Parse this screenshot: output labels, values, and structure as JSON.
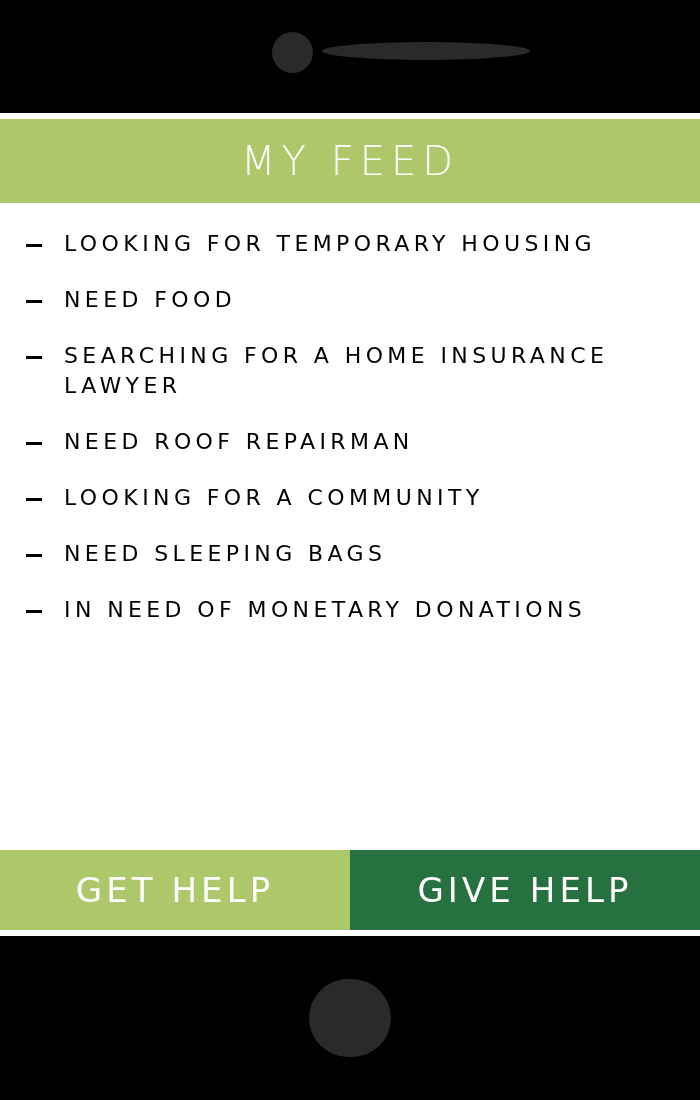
{
  "header": {
    "title": "MY FEED"
  },
  "feed": {
    "items": [
      {
        "text": "LOOKING FOR TEMPORARY HOUSING"
      },
      {
        "text": "NEED FOOD"
      },
      {
        "text": "SEARCHING FOR A HOME INSURANCE LAWYER"
      },
      {
        "text": "NEED ROOF REPAIRMAN"
      },
      {
        "text": "LOOKING FOR A COMMUNITY"
      },
      {
        "text": "NEED SLEEPING BAGS"
      },
      {
        "text": "IN NEED OF MONETARY DONATIONS"
      }
    ]
  },
  "actions": [
    {
      "label": "GET HELP",
      "color": "#adc86a"
    },
    {
      "label": "GIVE HELP",
      "color": "#277040"
    }
  ]
}
